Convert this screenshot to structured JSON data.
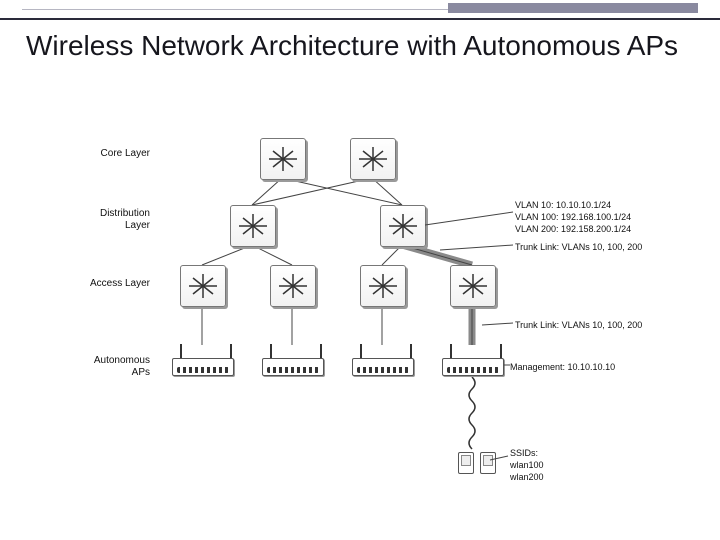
{
  "title": "Wireless Network Architecture with Autonomous APs",
  "layers": {
    "core": "Core Layer",
    "distribution": "Distribution Layer",
    "access": "Access Layer",
    "ap": "Autonomous APs"
  },
  "annotations": {
    "vlan10": "VLAN 10: 10.10.10.1/24",
    "vlan100": "VLAN 100: 192.168.100.1/24",
    "vlan200": "VLAN 200: 192.158.200.1/24",
    "trunk_dist": "Trunk Link: VLANs 10, 100, 200",
    "trunk_access": "Trunk Link: VLANs 10, 100, 200",
    "management": "Management: 10.10.10.10",
    "ssids_header": "SSIDs:",
    "ssid1": "wlan100",
    "ssid2": "wlan200"
  },
  "topology": {
    "core_switches": 2,
    "distribution_switches": 2,
    "access_switches": 4,
    "autonomous_aps": 4,
    "clients_under_last_ap": 2
  }
}
